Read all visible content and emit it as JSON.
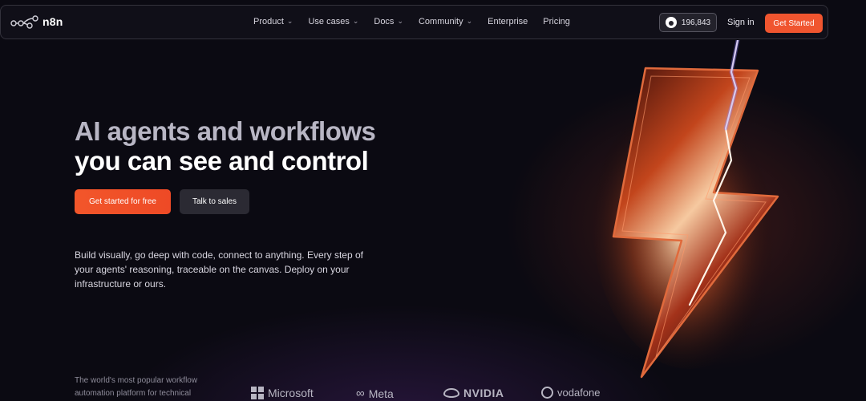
{
  "nav": {
    "logo": "n8n",
    "menu": [
      "Product",
      "Use cases",
      "Docs",
      "Community",
      "Enterprise",
      "Pricing"
    ],
    "menu_has_dropdown": [
      true,
      true,
      true,
      true,
      false,
      false
    ],
    "github_stars": "196,843",
    "signin_label": "Sign in",
    "cta_label": "Get Started"
  },
  "hero": {
    "title_line1": "AI agents and workflows",
    "title_line2": "you can see and control",
    "primary_cta": "Get started for free",
    "secondary_cta": "Talk to sales",
    "description_lines": [
      "Build visually, go deep with code, connect to anything. Every step of",
      "your agents' reasoning, traceable on the canvas. Deploy on your",
      "infrastructure or ours."
    ]
  },
  "footer_strip": {
    "tagline_lines": [
      "The world's most popular workflow",
      "automation platform for technical"
    ],
    "brands": [
      "Microsoft",
      "Meta",
      "NVIDIA",
      "vodafone"
    ]
  },
  "colors": {
    "accent": "#f0552f",
    "background": "#0b0a12",
    "nav_border": "#33323c"
  }
}
